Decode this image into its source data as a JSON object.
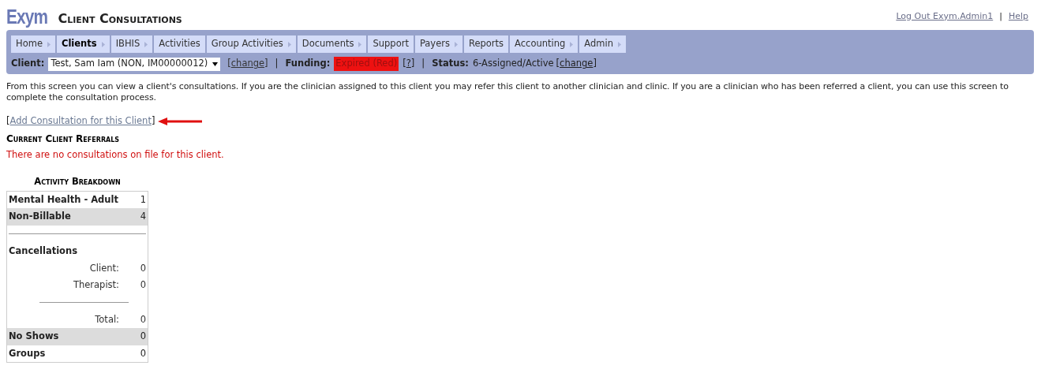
{
  "header": {
    "logo": "Exym",
    "title": "Client Consultations",
    "links": [
      {
        "label": "Log Out Exym.Admin1"
      },
      {
        "label": "Help"
      }
    ],
    "separator": "|"
  },
  "nav": [
    {
      "label": "Home",
      "selected": false,
      "has_submenu": true
    },
    {
      "label": "Clients",
      "selected": true,
      "has_submenu": true
    },
    {
      "label": "IBHIS",
      "selected": false,
      "has_submenu": true
    },
    {
      "label": "Activities",
      "selected": false,
      "has_submenu": false
    },
    {
      "label": "Group Activities",
      "selected": false,
      "has_submenu": true
    },
    {
      "label": "Documents",
      "selected": false,
      "has_submenu": true
    },
    {
      "label": "Support",
      "selected": false,
      "has_submenu": false
    },
    {
      "label": "Payers",
      "selected": false,
      "has_submenu": true
    },
    {
      "label": "Reports",
      "selected": false,
      "has_submenu": false
    },
    {
      "label": "Accounting",
      "selected": false,
      "has_submenu": true
    },
    {
      "label": "Admin",
      "selected": false,
      "has_submenu": true
    }
  ],
  "client_bar": {
    "open": "[",
    "close": "]",
    "client_label": "Client:",
    "client_value": "Test, Sam Iam (NON, IM00000012)",
    "change_link": "change",
    "sep": "|",
    "funding_label": "Funding:",
    "funding_value": "Expired (Red)",
    "help_link": "?",
    "status_label": "Status:",
    "status_value": "6-Assigned/Active",
    "status_change_link": "change"
  },
  "intro": "From this screen you can view a client's consultations. If you are the clinician assigned to this client you may refer this client to another clinician and clinic. If you are a clinician who has been referred a client, you can use this screen to complete the consultation process.",
  "add_link": {
    "open": "[",
    "label": "Add Consultation for this Client",
    "close": "]"
  },
  "referrals": {
    "title": "Current Client Referrals",
    "empty_message": "There are no consultations on file for this client."
  },
  "breakdown": {
    "title": "Activity Breakdown",
    "rows": [
      {
        "kind": "item",
        "label": "Mental Health - Adult",
        "value": "1",
        "shaded": false
      },
      {
        "kind": "item",
        "label": "Non-Billable",
        "value": "4",
        "shaded": true
      },
      {
        "kind": "divider"
      },
      {
        "kind": "heading",
        "label": "Cancellations"
      },
      {
        "kind": "sub",
        "label": "Client:",
        "value": "0"
      },
      {
        "kind": "sub",
        "label": "Therapist:",
        "value": "0"
      },
      {
        "kind": "subdivider"
      },
      {
        "kind": "sub",
        "label": "Total:",
        "value": "0"
      },
      {
        "kind": "item",
        "label": "No Shows",
        "value": "0",
        "shaded": true
      },
      {
        "kind": "item",
        "label": "Groups",
        "value": "0",
        "shaded": false
      }
    ]
  }
}
